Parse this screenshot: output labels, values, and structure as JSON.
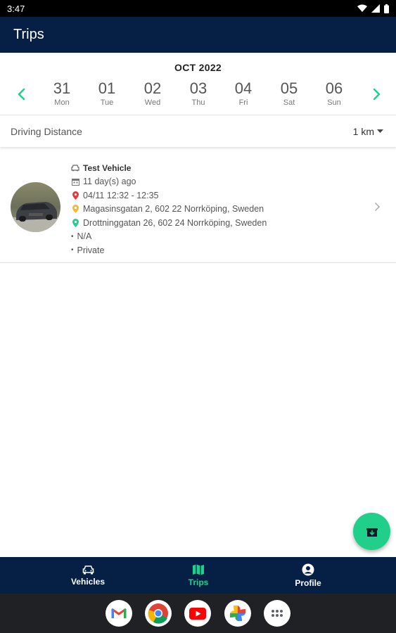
{
  "status_bar": {
    "time": "3:47"
  },
  "app_bar": {
    "title": "Trips"
  },
  "calendar": {
    "month": "OCT 2022",
    "days": [
      {
        "num": "31",
        "name": "Mon"
      },
      {
        "num": "01",
        "name": "Tue"
      },
      {
        "num": "02",
        "name": "Wed"
      },
      {
        "num": "03",
        "name": "Thu"
      },
      {
        "num": "04",
        "name": "Fri"
      },
      {
        "num": "05",
        "name": "Sat"
      },
      {
        "num": "06",
        "name": "Sun"
      }
    ]
  },
  "distance": {
    "label": "Driving Distance",
    "value": "1 km"
  },
  "trip": {
    "vehicle": "Test Vehicle",
    "ago": "11 day(s) ago",
    "time_range": "04/11 12:32 - 12:35",
    "start_address": "Magasinsgatan 2, 602 22 Norrköping, Sweden",
    "end_address": "Drottninggatan 26, 602 24 Norrköping, Sweden",
    "purpose": "N/A",
    "category": "Private"
  },
  "bottom_nav": {
    "items": [
      {
        "label": "Vehicles",
        "icon": "car-icon"
      },
      {
        "label": "Trips",
        "icon": "map-icon"
      },
      {
        "label": "Profile",
        "icon": "profile-icon"
      }
    ],
    "active": "Trips"
  },
  "dock": {
    "apps": [
      "gmail-icon",
      "chrome-icon",
      "youtube-icon",
      "photos-icon",
      "app-drawer-icon"
    ]
  },
  "colors": {
    "primary_dark": "#062045",
    "accent": "#1fcf8a",
    "marker_red": "#e53935",
    "marker_yellow": "#f9b82b",
    "marker_green": "#1fcf8a"
  }
}
